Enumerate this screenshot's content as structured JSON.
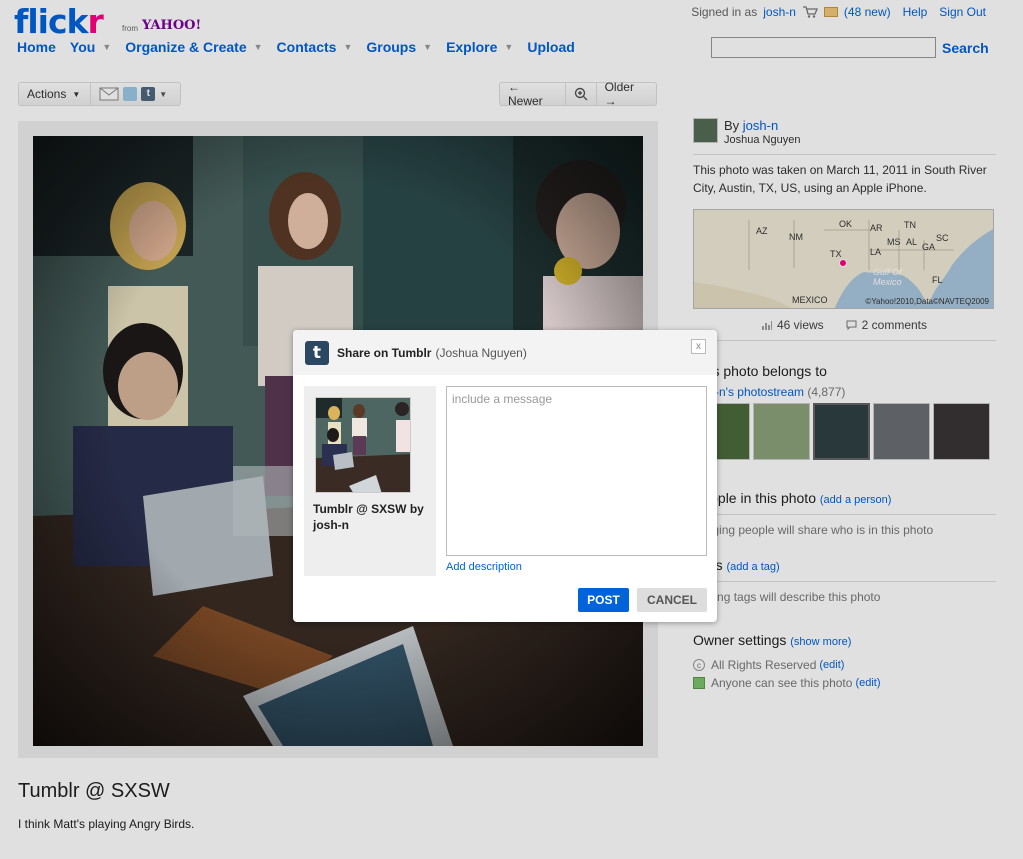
{
  "brand": {
    "logo_blue": "flick",
    "logo_pink": "r",
    "from": "from",
    "yahoo": "YAHOO!",
    "blue": "#0063dc",
    "pink": "#ff0084"
  },
  "account": {
    "signed_in_as": "Signed in as",
    "username": "josh-n",
    "mail_count": "(48 new)",
    "help": "Help",
    "sign_out": "Sign Out"
  },
  "nav": {
    "items": [
      {
        "label": "Home",
        "dropdown": false
      },
      {
        "label": "You",
        "dropdown": true
      },
      {
        "label": "Organize & Create",
        "dropdown": true
      },
      {
        "label": "Contacts",
        "dropdown": true
      },
      {
        "label": "Groups",
        "dropdown": true
      },
      {
        "label": "Explore",
        "dropdown": true
      },
      {
        "label": "Upload",
        "dropdown": false
      }
    ]
  },
  "search": {
    "value": "",
    "button": "Search"
  },
  "toolbar": {
    "actions": "Actions",
    "newer": "← Newer",
    "older": "Older →",
    "icons": [
      "email-icon",
      "twitter-icon",
      "tumblr-icon",
      "share-dropdown-icon",
      "zoom-icon"
    ]
  },
  "photo": {
    "title": "Tumblr @ SXSW",
    "description": "I think Matt's playing Angry Birds."
  },
  "sidebar": {
    "by": "By",
    "owner": "josh-n",
    "owner_real_name": "Joshua Nguyen",
    "taken_prefix": "This photo was taken on",
    "taken_date": "March 11, 2011",
    "taken_in": "in",
    "taken_location": "South River City, Austin, TX, US",
    "taken_using": ", using an",
    "taken_camera": "Apple iPhone",
    "map": {
      "labels": [
        "AZ",
        "NM",
        "OK",
        "AR",
        "TN",
        "SC",
        "MS",
        "AL",
        "GA",
        "TX",
        "LA",
        "FL",
        "Gulf Of",
        "Mexico",
        "MEXICO"
      ],
      "copyright": "©Yahoo!2010,Data©NAVTEQ2009"
    },
    "views": "46 views",
    "comments": "2 comments",
    "belongs_to": "This photo belongs to",
    "photostream": "josh-n's photostream",
    "photostream_count": "(4,877)",
    "people_heading": "People in this photo",
    "add_person": "(add a person)",
    "people_note": "Tagging people will share who is in this photo",
    "tags_heading": "Tags",
    "add_tag": "(add a tag)",
    "tags_note": "Adding tags will describe this photo",
    "owner_settings": "Owner settings",
    "show_more": "(show more)",
    "rights": "All Rights Reserved",
    "rights_edit": "(edit)",
    "privacy": "Anyone can see this photo",
    "privacy_edit": "(edit)"
  },
  "dialog": {
    "title": "Share on Tumblr",
    "subtitle": "(Joshua Nguyen)",
    "close": "x",
    "caption": "Tumblr @ SXSW by josh-n",
    "message_placeholder": "include a message",
    "add_description": "Add description",
    "post": "POST",
    "cancel": "CANCEL"
  }
}
